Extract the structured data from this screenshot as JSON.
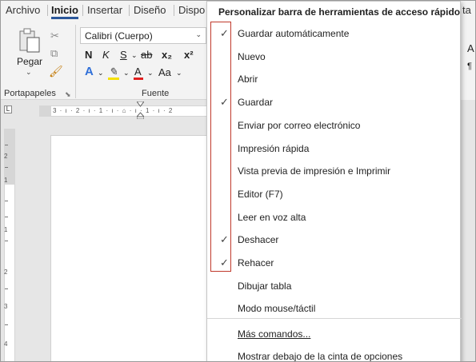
{
  "ribbon": {
    "tabs": [
      "Archivo",
      "Inicio",
      "Insertar",
      "Diseño",
      "Dispo",
      "ta"
    ],
    "active_tab": "Inicio",
    "clipboard": {
      "paste_label": "Pegar",
      "group_label": "Portapapeles"
    },
    "font": {
      "font_name": "Calibri (Cuerpo)",
      "group_label": "Fuente",
      "bold": "N",
      "italic": "K",
      "underline": "S",
      "strike": "ab",
      "subscript": "x₂",
      "superscript": "x²",
      "font_color_glyph": "A",
      "highlight_glyph": "A",
      "text_effects_glyph": "A",
      "change_case": "Aa"
    },
    "right_letters": [
      "A",
      "¶"
    ]
  },
  "ruler": {
    "marks": "3 · ı · 2 · ı · 1 · ı · ⌂ · ı · 1 · ı · 2",
    "corner": "L",
    "vertical_numbers": [
      "2",
      "1",
      "1",
      "2",
      "3",
      "4"
    ]
  },
  "menu": {
    "title": "Personalizar barra de herramientas de acceso rápido",
    "items": [
      {
        "label": "Guardar automáticamente",
        "checked": true
      },
      {
        "label": "Nuevo",
        "checked": false
      },
      {
        "label": "Abrir",
        "checked": false
      },
      {
        "label": "Guardar",
        "checked": true
      },
      {
        "label": "Enviar por correo electrónico",
        "checked": false
      },
      {
        "label": "Impresión rápida",
        "checked": false
      },
      {
        "label": "Vista previa de impresión e Imprimir",
        "checked": false
      },
      {
        "label": "Editor (F7)",
        "checked": false
      },
      {
        "label": "Leer en voz alta",
        "checked": false
      },
      {
        "label": "Deshacer",
        "checked": true
      },
      {
        "label": "Rehacer",
        "checked": true
      },
      {
        "label": "Dibujar tabla",
        "checked": false
      },
      {
        "label": "Modo mouse/táctil",
        "checked": false
      }
    ],
    "more_commands": "Más comandos...",
    "show_below": "Mostrar debajo de la cinta de opciones",
    "check_glyph": "✓"
  },
  "colors": {
    "accent": "#2b579a",
    "highlight_border": "#c0392b",
    "font_color_red": "#e02020",
    "highlight_yellow": "#f5e000",
    "text_effect_blue": "#2f6fd8"
  }
}
